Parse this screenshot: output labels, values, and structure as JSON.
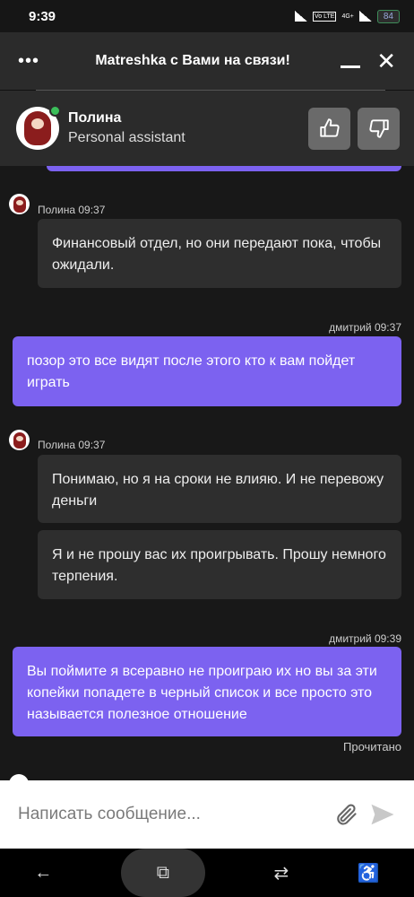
{
  "status_bar": {
    "time": "9:39",
    "volte": "Vo LTE",
    "network": "4G+",
    "battery": "84"
  },
  "chat_header": {
    "title": "Matreshka с Вами на связи!"
  },
  "agent": {
    "name": "Полина",
    "role": "Personal assistant"
  },
  "messages": [
    {
      "sender": "agent",
      "meta": "Полина 09:37",
      "bubbles": [
        "Финансовый отдел, но они передают пока, чтобы ожидали."
      ]
    },
    {
      "sender": "user",
      "meta": "дмитрий 09:37",
      "bubbles": [
        "позор это все видят после этого кто к вам пойдет играть"
      ]
    },
    {
      "sender": "agent",
      "meta": "Полина 09:37",
      "bubbles": [
        "Понимаю, но я на сроки не влияю. И не перевожу деньги",
        "Я и не прошу вас их проигрывать. Прошу немного терпения."
      ]
    },
    {
      "sender": "user",
      "meta": "дмитрий 09:39",
      "bubbles": [
        "Вы поймите я всеравно не проиграю их но вы за эти копейки попадете в черный список и все просто это называется полезное отношение"
      ]
    }
  ],
  "read_status": "Прочитано",
  "input": {
    "placeholder": "Написать сообщение..."
  },
  "colors": {
    "user_bubble": "#7c62f0",
    "agent_bubble": "#2e2e2e",
    "header": "#2b2b2b",
    "online": "#3bbf5a"
  }
}
